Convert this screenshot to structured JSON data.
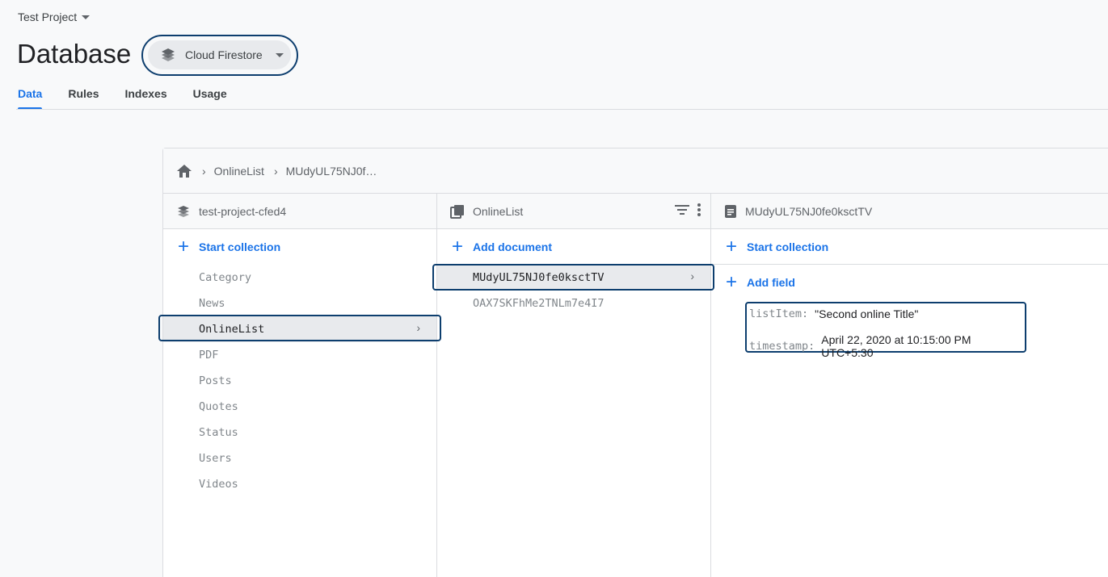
{
  "header": {
    "project_name": "Test Project",
    "page_title": "Database",
    "product": "Cloud Firestore"
  },
  "tabs": [
    {
      "label": "Data",
      "active": true
    },
    {
      "label": "Rules"
    },
    {
      "label": "Indexes"
    },
    {
      "label": "Usage"
    }
  ],
  "breadcrumb": {
    "items": [
      "OnlineList",
      "MUdyUL75NJ0f…"
    ]
  },
  "columns": {
    "root": {
      "title": "test-project-cfed4",
      "action": "Start collection",
      "items": [
        "Category",
        "News",
        "OnlineList",
        "PDF",
        "Posts",
        "Quotes",
        "Status",
        "Users",
        "Videos"
      ],
      "selected": "OnlineList"
    },
    "collection": {
      "title": "OnlineList",
      "action": "Add document",
      "items": [
        "MUdyUL75NJ0fe0ksctTV",
        "OAX7SKFhMe2TNLm7e4I7"
      ],
      "selected": "MUdyUL75NJ0fe0ksctTV"
    },
    "document": {
      "title": "MUdyUL75NJ0fe0ksctTV",
      "action_collection": "Start collection",
      "action_field": "Add field",
      "fields": [
        {
          "key": "listItem:",
          "value": "\"Second online Title\""
        },
        {
          "key": "timestamp:",
          "value": "April 22, 2020 at 10:15:00 PM UTC+5:30"
        }
      ]
    }
  },
  "colors": {
    "accent": "#1a73e8",
    "highlight_border": "#0d3e6e",
    "selected_bg": "#e8eaed"
  }
}
